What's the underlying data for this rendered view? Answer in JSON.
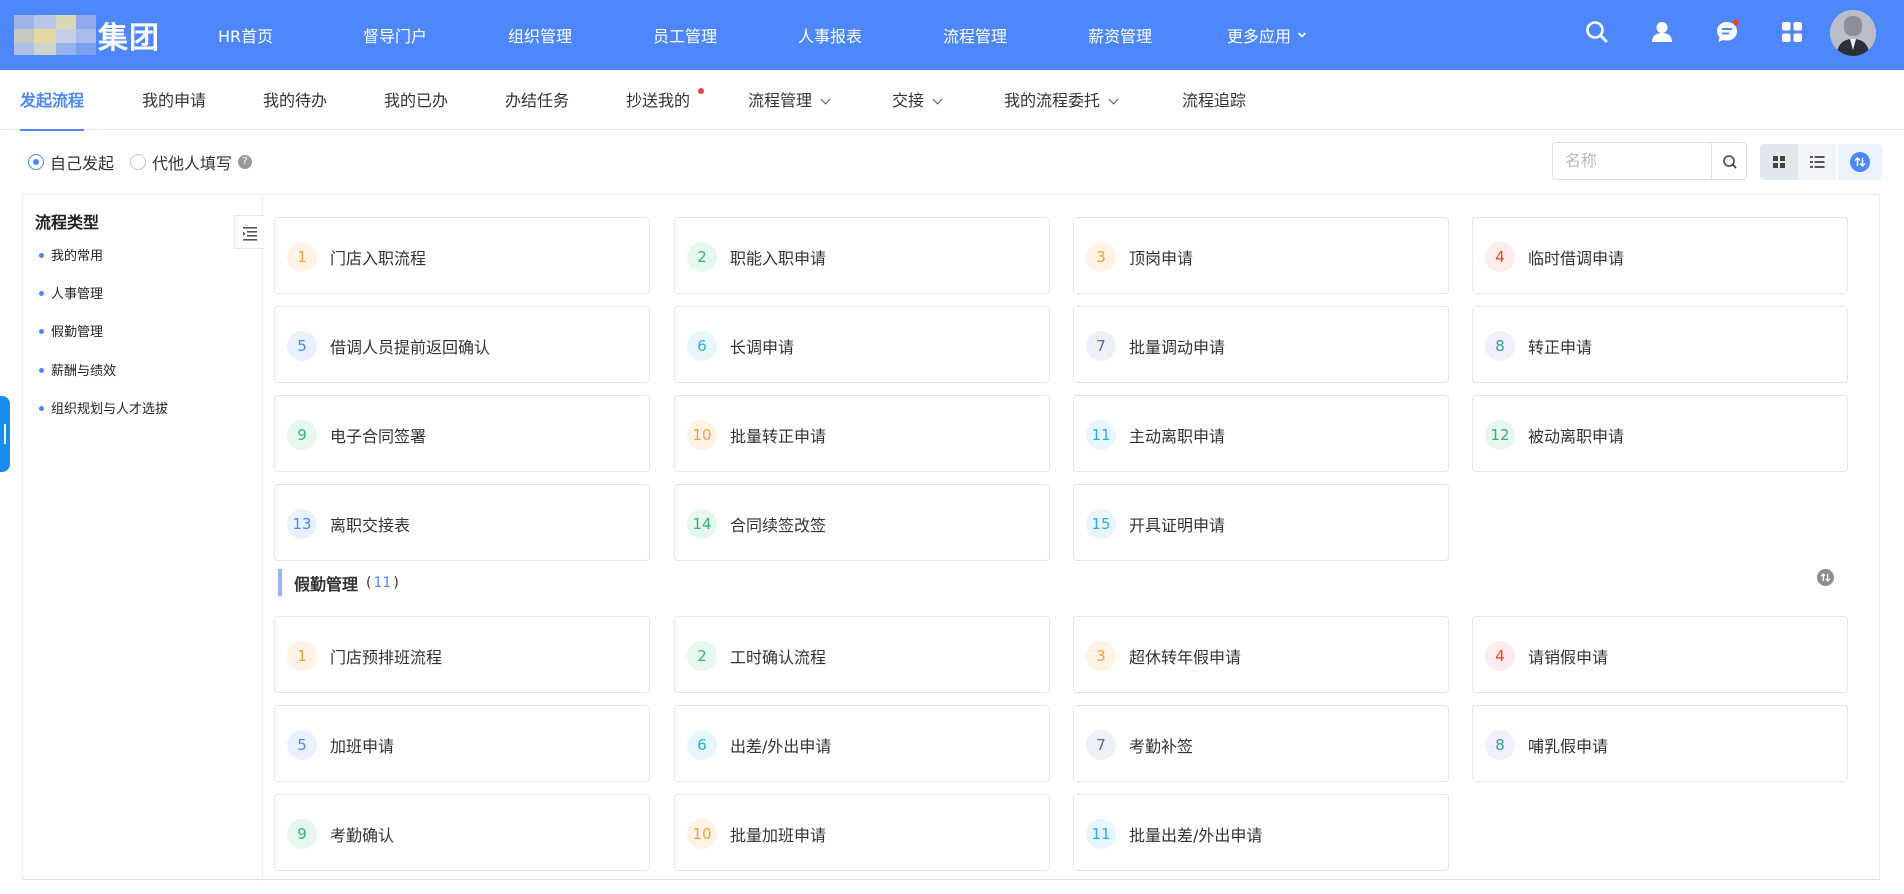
{
  "header": {
    "logo_text": "集团",
    "nav": [
      "HR首页",
      "督导门户",
      "组织管理",
      "员工管理",
      "人事报表",
      "流程管理",
      "薪资管理",
      "更多应用"
    ],
    "icons": [
      "search-icon",
      "user-icon",
      "chat-icon",
      "apps-icon"
    ],
    "accent_color": "#4d87fb"
  },
  "tabs": [
    "发起流程",
    "我的申请",
    "我的待办",
    "我的已办",
    "办结任务",
    "抄送我的",
    "流程管理",
    "交接",
    "我的流程委托",
    "流程追踪"
  ],
  "filter": {
    "self_label": "自己发起",
    "proxy_label": "代他人填写",
    "help": "?",
    "search_placeholder": "名称"
  },
  "sidebar": {
    "title": "流程类型",
    "items": [
      "我的常用",
      "人事管理",
      "假勤管理",
      "薪酬与绩效",
      "组织规划与人才选拔"
    ]
  },
  "group1": {
    "cards": [
      {
        "n": "1",
        "label": "门店入职流程"
      },
      {
        "n": "2",
        "label": "职能入职申请"
      },
      {
        "n": "3",
        "label": "顶岗申请"
      },
      {
        "n": "4",
        "label": "临时借调申请"
      },
      {
        "n": "5",
        "label": "借调人员提前返回确认"
      },
      {
        "n": "6",
        "label": "长调申请"
      },
      {
        "n": "7",
        "label": "批量调动申请"
      },
      {
        "n": "8",
        "label": "转正申请"
      },
      {
        "n": "9",
        "label": "电子合同签署"
      },
      {
        "n": "10",
        "label": "批量转正申请"
      },
      {
        "n": "11",
        "label": "主动离职申请"
      },
      {
        "n": "12",
        "label": "被动离职申请"
      },
      {
        "n": "13",
        "label": "离职交接表"
      },
      {
        "n": "14",
        "label": "合同续签改签"
      },
      {
        "n": "15",
        "label": "开具证明申请"
      }
    ]
  },
  "group2": {
    "title": "假勤管理",
    "count": "11",
    "paren_open": "(",
    "paren_close": ")",
    "cards": [
      {
        "n": "1",
        "label": "门店预排班流程"
      },
      {
        "n": "2",
        "label": "工时确认流程"
      },
      {
        "n": "3",
        "label": "超休转年假申请"
      },
      {
        "n": "4",
        "label": "请销假申请"
      },
      {
        "n": "5",
        "label": "加班申请"
      },
      {
        "n": "6",
        "label": "出差/外出申请"
      },
      {
        "n": "7",
        "label": "考勤补签"
      },
      {
        "n": "8",
        "label": "哺乳假申请"
      },
      {
        "n": "9",
        "label": "考勤确认"
      },
      {
        "n": "10",
        "label": "批量加班申请"
      },
      {
        "n": "11",
        "label": "批量出差/外出申请"
      }
    ]
  }
}
